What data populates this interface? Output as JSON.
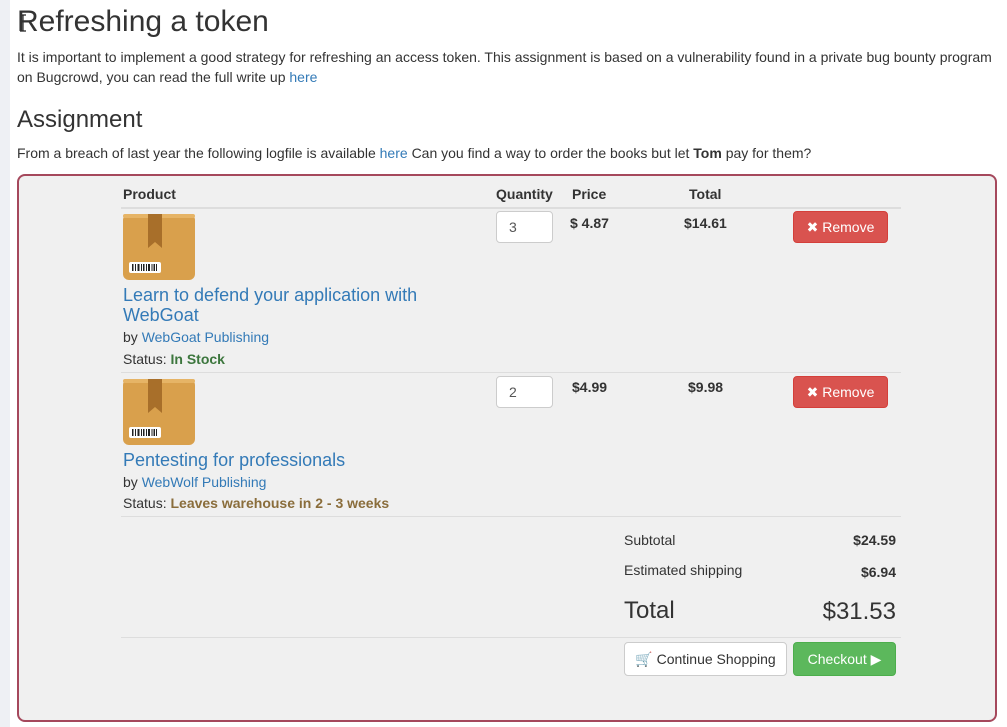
{
  "page": {
    "title": "Refreshing a token",
    "intro_text": "It is important to implement a good strategy for refreshing an access token. This assignment is based on a vulnerability found in a private bug bounty program on Bugcrowd, you can read the full write up",
    "intro_link": "here",
    "assignment_heading": "Assignment",
    "assignment_text_1": "From a breach of last year the following logfile is available",
    "assignment_link": "here",
    "assignment_text_2": "Can you find a way to order the books but let",
    "assignment_bold": "Tom",
    "assignment_text_3": "pay for them?"
  },
  "cart": {
    "headers": {
      "product": "Product",
      "quantity": "Quantity",
      "price": "Price",
      "total": "Total"
    },
    "items": [
      {
        "name": "Learn to defend your application with WebGoat",
        "by_label": "by",
        "publisher": "WebGoat Publishing",
        "status_label": "Status:",
        "status": "In Stock",
        "quantity": "3",
        "price": "$ 4.87",
        "total": "$14.61",
        "remove_label": "Remove"
      },
      {
        "name": "Pentesting for professionals",
        "by_label": "by",
        "publisher": "WebWolf Publishing",
        "status_label": "Status:",
        "status": "Leaves warehouse in 2 - 3 weeks",
        "quantity": "2",
        "price": "$4.99",
        "total": "$9.98",
        "remove_label": "Remove"
      }
    ],
    "subtotal_label": "Subtotal",
    "subtotal": "$24.59",
    "shipping_label": "Estimated shipping",
    "shipping": "$6.94",
    "total_label": "Total",
    "total": "$31.53",
    "continue_label": "Continue Shopping",
    "checkout_label": "Checkout"
  },
  "colors": {
    "panel_border": "#a5485c",
    "link": "#337ab7",
    "remove": "#d9534f",
    "checkout": "#5cb85c",
    "in_stock": "#3c763d",
    "delayed": "#8a6d3b"
  }
}
